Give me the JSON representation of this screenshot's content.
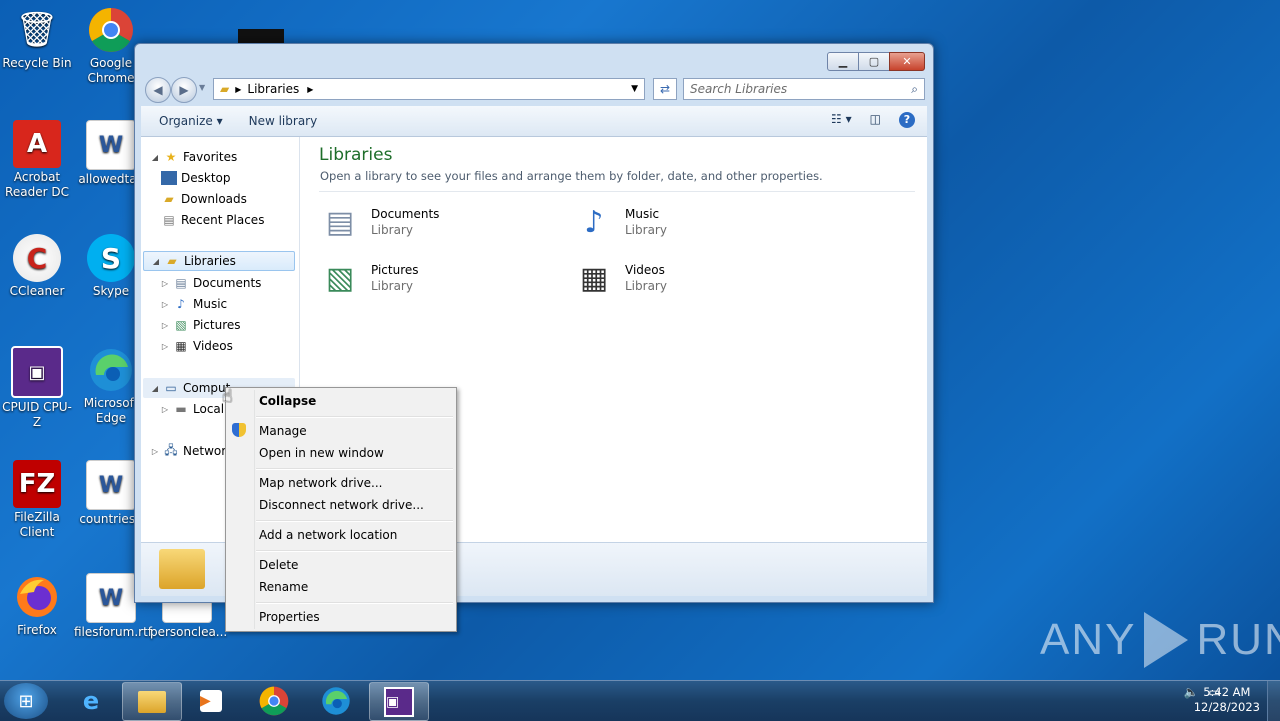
{
  "desktop": {
    "icons": [
      {
        "label": "Recycle Bin"
      },
      {
        "label": "Google Chrome"
      },
      {
        "label": "Acrobat Reader DC"
      },
      {
        "label": "allowedtax"
      },
      {
        "label": "CCleaner"
      },
      {
        "label": "Skype"
      },
      {
        "label": "CPUID CPU-Z"
      },
      {
        "label": "Microsoft Edge"
      },
      {
        "label": "FileZilla Client"
      },
      {
        "label": "countriesg"
      },
      {
        "label": "Firefox"
      },
      {
        "label": "filesforum.rtf"
      },
      {
        "label": "personclea..."
      }
    ]
  },
  "window": {
    "address_segments": [
      "Libraries"
    ],
    "search_placeholder": "Search Libraries",
    "toolbar": {
      "organize": "Organize ▾",
      "new_library": "New library"
    },
    "nav": {
      "favorites": "Favorites",
      "desktop": "Desktop",
      "downloads": "Downloads",
      "recent_places": "Recent Places",
      "libraries": "Libraries",
      "documents": "Documents",
      "music": "Music",
      "pictures": "Pictures",
      "videos": "Videos",
      "computer": "Comput",
      "local_disk": "Local",
      "network": "Network"
    },
    "main": {
      "title": "Libraries",
      "subtitle": "Open a library to see your files and arrange them by folder, date, and other properties.",
      "libraries": [
        {
          "name": "Documents",
          "kind": "Library"
        },
        {
          "name": "Music",
          "kind": "Library"
        },
        {
          "name": "Pictures",
          "kind": "Library"
        },
        {
          "name": "Videos",
          "kind": "Library"
        }
      ]
    }
  },
  "context_menu": {
    "collapse": "Collapse",
    "manage": "Manage",
    "open_new_window": "Open in new window",
    "map_network_drive": "Map network drive...",
    "disconnect_network_drive": "Disconnect network drive...",
    "add_network_location": "Add a network location",
    "delete": "Delete",
    "rename": "Rename",
    "properties": "Properties"
  },
  "taskbar": {
    "clock_time": "5:42 AM",
    "clock_date": "12/28/2023"
  },
  "watermark": {
    "left": "ANY",
    "right": "RUN"
  }
}
